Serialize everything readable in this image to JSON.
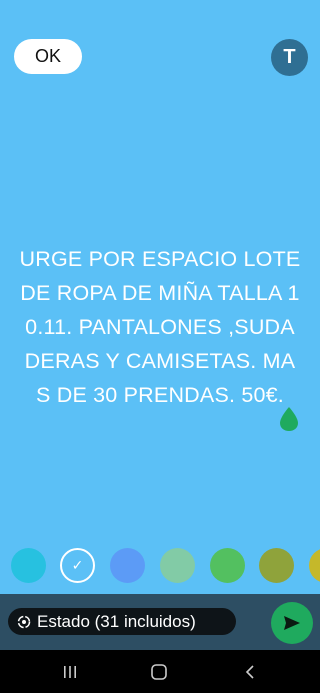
{
  "header": {
    "ok_label": "OK",
    "avatar_initial": "T"
  },
  "status": {
    "text": "URGE POR ESPACIO LOTE DE ROPA DE MIÑA TALLA 10.11. PANTALONES ,SUDADERAS Y CAMISETAS. MAS DE 30 PRENDAS. 50€.",
    "background_color": "#5bc0f6"
  },
  "palette": {
    "colors": [
      "#27c1e0",
      "#5bc0f6",
      "#5c9bf6",
      "#82cba6",
      "#53c060",
      "#8fa33b",
      "#c5b82a"
    ],
    "selected_index": 1
  },
  "footer": {
    "recipients_label": "Estado (31 incluidos)",
    "send_icon": "send-icon"
  },
  "nav": {
    "recents_icon": "recents-icon",
    "home_icon": "home-icon",
    "back_icon": "back-icon"
  }
}
